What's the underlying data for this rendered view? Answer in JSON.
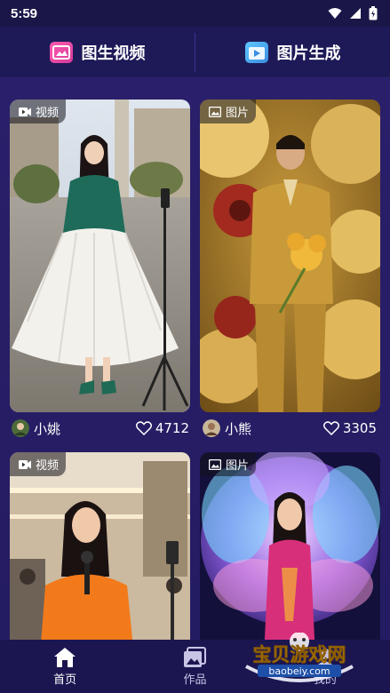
{
  "status": {
    "time": "5:59"
  },
  "top_tabs": [
    {
      "label": "图生视频",
      "icon": "image-to-video-icon"
    },
    {
      "label": "图片生成",
      "icon": "image-generate-icon"
    }
  ],
  "cards": [
    {
      "badge": "视频",
      "badge_icon": "video-icon",
      "author": "小姚",
      "likes": "4712"
    },
    {
      "badge": "图片",
      "badge_icon": "image-icon",
      "author": "小熊",
      "likes": "3305"
    },
    {
      "badge": "视频",
      "badge_icon": "video-icon"
    },
    {
      "badge": "图片",
      "badge_icon": "image-icon"
    }
  ],
  "nav": [
    {
      "label": "首页",
      "icon": "home-icon"
    },
    {
      "label": "作品",
      "icon": "gallery-icon"
    },
    {
      "label": "我的",
      "icon": "profile-icon"
    }
  ],
  "watermark": {
    "title": "宝贝游戏网",
    "url": "baobeiy.com"
  },
  "colors": {
    "background": "#1b1650",
    "accent_pink": "#ff5bb0",
    "accent_blue": "#5fc7ff"
  }
}
